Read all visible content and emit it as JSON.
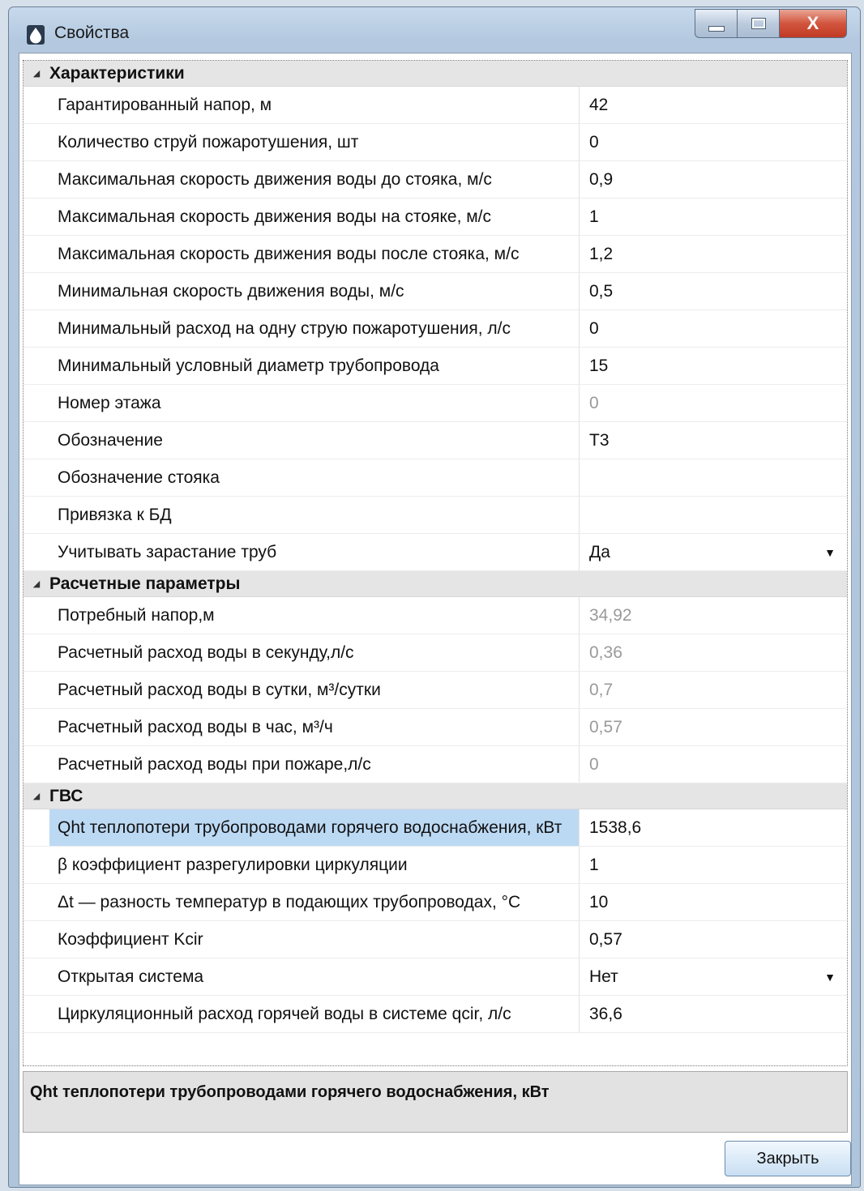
{
  "window": {
    "title": "Свойства",
    "controls": {
      "close_glyph": "X"
    }
  },
  "categories": [
    {
      "label": "Характеристики",
      "rows": [
        {
          "name": "Гарантированный напор, м",
          "value": "42"
        },
        {
          "name": "Количество струй пожаротушения, шт",
          "value": "0"
        },
        {
          "name": "Максимальная скорость движения воды до стояка, м/с",
          "value": "0,9"
        },
        {
          "name": "Максимальная скорость движения воды на стояке, м/с",
          "value": "1"
        },
        {
          "name": "Максимальная скорость движения воды после стояка, м/с",
          "value": "1,2"
        },
        {
          "name": "Минимальная скорость движения воды, м/с",
          "value": "0,5"
        },
        {
          "name": "Минимальный расход на одну струю пожаротушения, л/с",
          "value": "0"
        },
        {
          "name": "Минимальный условный диаметр трубопровода",
          "value": "15"
        },
        {
          "name": "Номер этажа",
          "value": "0"
        },
        {
          "name": "Обозначение",
          "value": "Т3"
        },
        {
          "name": "Обозначение стояка",
          "value": ""
        },
        {
          "name": "Привязка к БД",
          "value": ""
        },
        {
          "name": "Учитывать зарастание труб",
          "value": "Да"
        }
      ]
    },
    {
      "label": "Расчетные параметры",
      "rows": [
        {
          "name": "Потребный напор,м",
          "value": "34,92"
        },
        {
          "name": "Расчетный расход воды в секунду,л/с",
          "value": "0,36"
        },
        {
          "name": "Расчетный расход воды в сутки, м³/сутки",
          "value": "0,7"
        },
        {
          "name": "Расчетный расход воды в час, м³/ч",
          "value": "0,57"
        },
        {
          "name": "Расчетный расход воды при пожаре,л/с",
          "value": "0"
        }
      ]
    },
    {
      "label": "ГВС",
      "rows": [
        {
          "name": "Qht  теплопотери трубопроводами горячего водоснабжения, кВт",
          "value": "1538,6"
        },
        {
          "name": "β  коэффициент разрегулировки циркуляции",
          "value": "1"
        },
        {
          "name": "Δt — разность температур в подающих трубопроводах, °C",
          "value": "10"
        },
        {
          "name": "Коэффициент Kcir",
          "value": "0,57"
        },
        {
          "name": "Открытая система",
          "value": "Нет"
        },
        {
          "name": "Циркуляционный расход горячей воды в системе qcir, л/с",
          "value": "36,6"
        }
      ]
    }
  ],
  "description": {
    "text": "Qht  теплопотери трубопроводами горячего водоснабжения, кВт"
  },
  "buttons": {
    "close_label": "Закрыть"
  }
}
